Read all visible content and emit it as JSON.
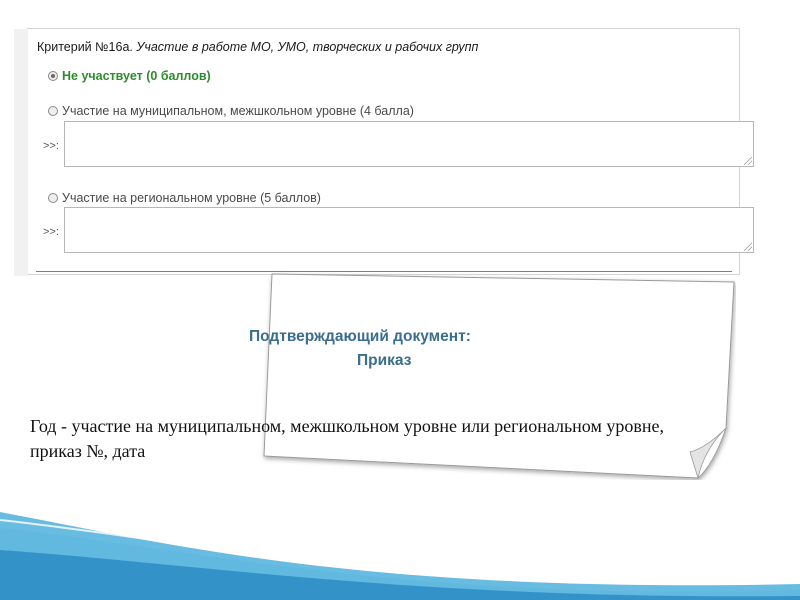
{
  "form": {
    "criterion_number": "Критерий №16а.",
    "criterion_text": "Участие в работе МО, УМО, творческих и рабочих групп",
    "options": [
      {
        "label": "Не участвует (0 баллов)",
        "selected": true
      },
      {
        "label": "Участие на муниципальном, межшкольном уровне (4 балла)",
        "selected": false
      },
      {
        "label": "Участие на региональном уровне (5 баллов)",
        "selected": false
      }
    ],
    "prompt_label": ">>:",
    "comment_fields": [
      {
        "value": ""
      },
      {
        "value": ""
      }
    ]
  },
  "note": {
    "title": "Подтверждающий документ:",
    "value": "Приказ"
  },
  "body_text": "Год - участие на муниципальном, межшкольном уровне или региональном уровне, приказ №, дата",
  "colors": {
    "selected_option": "#2e8b2e",
    "note_text": "#3a6e8c",
    "wave_primary": "#4fb0dc",
    "wave_light": "#c8e9f6"
  }
}
